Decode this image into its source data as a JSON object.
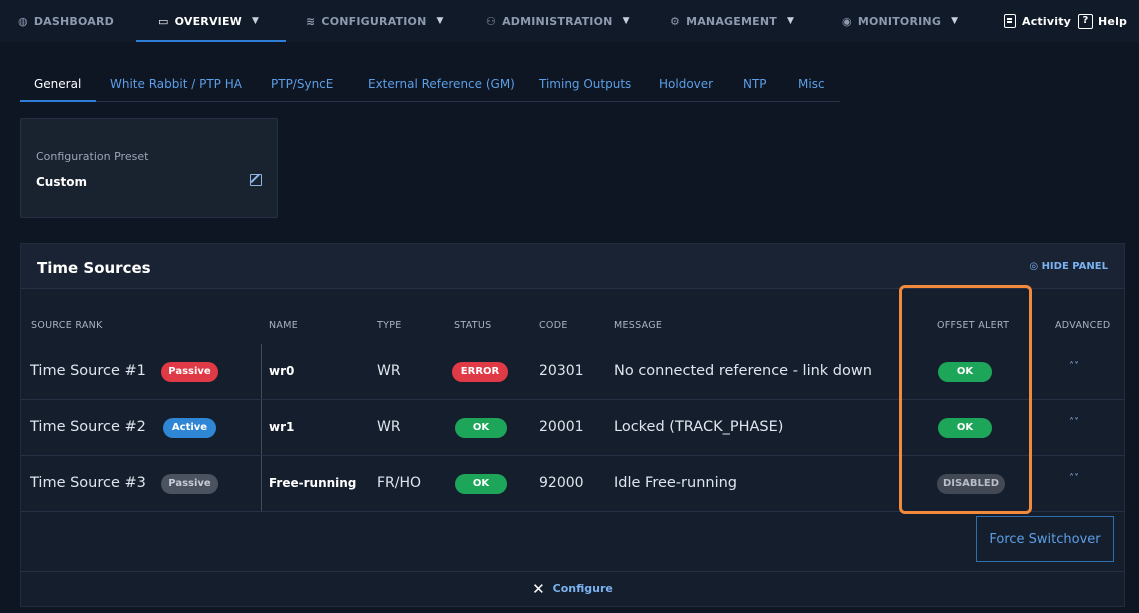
{
  "nav": {
    "items": [
      {
        "icon": "dashboard-icon",
        "glyph": "◍",
        "label": "DASHBOARD",
        "caret": ""
      },
      {
        "icon": "monitor-icon",
        "glyph": "▭",
        "label": "OVERVIEW",
        "caret": "▼"
      },
      {
        "icon": "sliders-icon",
        "glyph": "≋",
        "label": "CONFIGURATION",
        "caret": "▼"
      },
      {
        "icon": "network-icon",
        "glyph": "⚇",
        "label": "ADMINISTRATION",
        "caret": "▼"
      },
      {
        "icon": "gear-icon",
        "glyph": "⚙",
        "label": "MANAGEMENT",
        "caret": "▼"
      },
      {
        "icon": "eye-icon",
        "glyph": "◉",
        "label": "MONITORING",
        "caret": "▼"
      }
    ],
    "activity": "Activity",
    "help": "Help",
    "help_glyph": "?"
  },
  "subtabs": [
    "General",
    "White Rabbit / PTP HA",
    "PTP/SyncE",
    "External Reference (GM)",
    "Timing Outputs",
    "Holdover",
    "NTP",
    "Misc"
  ],
  "preset": {
    "label": "Configuration Preset",
    "value": "Custom"
  },
  "panel": {
    "title": "Time Sources",
    "hide_label": "◎ HIDE PANEL",
    "columns": {
      "rank": "SOURCE RANK",
      "name": "NAME",
      "type": "TYPE",
      "status": "STATUS",
      "code": "CODE",
      "message": "MESSAGE",
      "offset_alert": "OFFSET ALERT",
      "advanced": "ADVANCED"
    },
    "rows": [
      {
        "rank": "Time Source #1",
        "state": "Passive",
        "name": "wr0",
        "type": "WR",
        "status": "ERROR",
        "code": "20301",
        "message": "No connected reference - link down",
        "offset_alert": "OK",
        "chev": "˄˅"
      },
      {
        "rank": "Time Source #2",
        "state": "Active",
        "name": "wr1",
        "type": "WR",
        "status": "OK",
        "code": "20001",
        "message": "Locked (TRACK_PHASE)",
        "offset_alert": "OK",
        "chev": "˄˅"
      },
      {
        "rank": "Time Source #3",
        "state": "Passive",
        "name": "Free-running",
        "type": "FR/HO",
        "status": "OK",
        "code": "92000",
        "message": "Idle Free-running",
        "offset_alert": "DISABLED",
        "chev": "˄˅"
      }
    ],
    "force_switchover": "Force Switchover",
    "configure": "Configure",
    "configure_glyph": "✕"
  },
  "colors": {
    "accent": "#2f7fd8",
    "highlight": "#f28a3c",
    "error": "#e03a47",
    "ok": "#1da65a",
    "active": "#2f86d4"
  }
}
